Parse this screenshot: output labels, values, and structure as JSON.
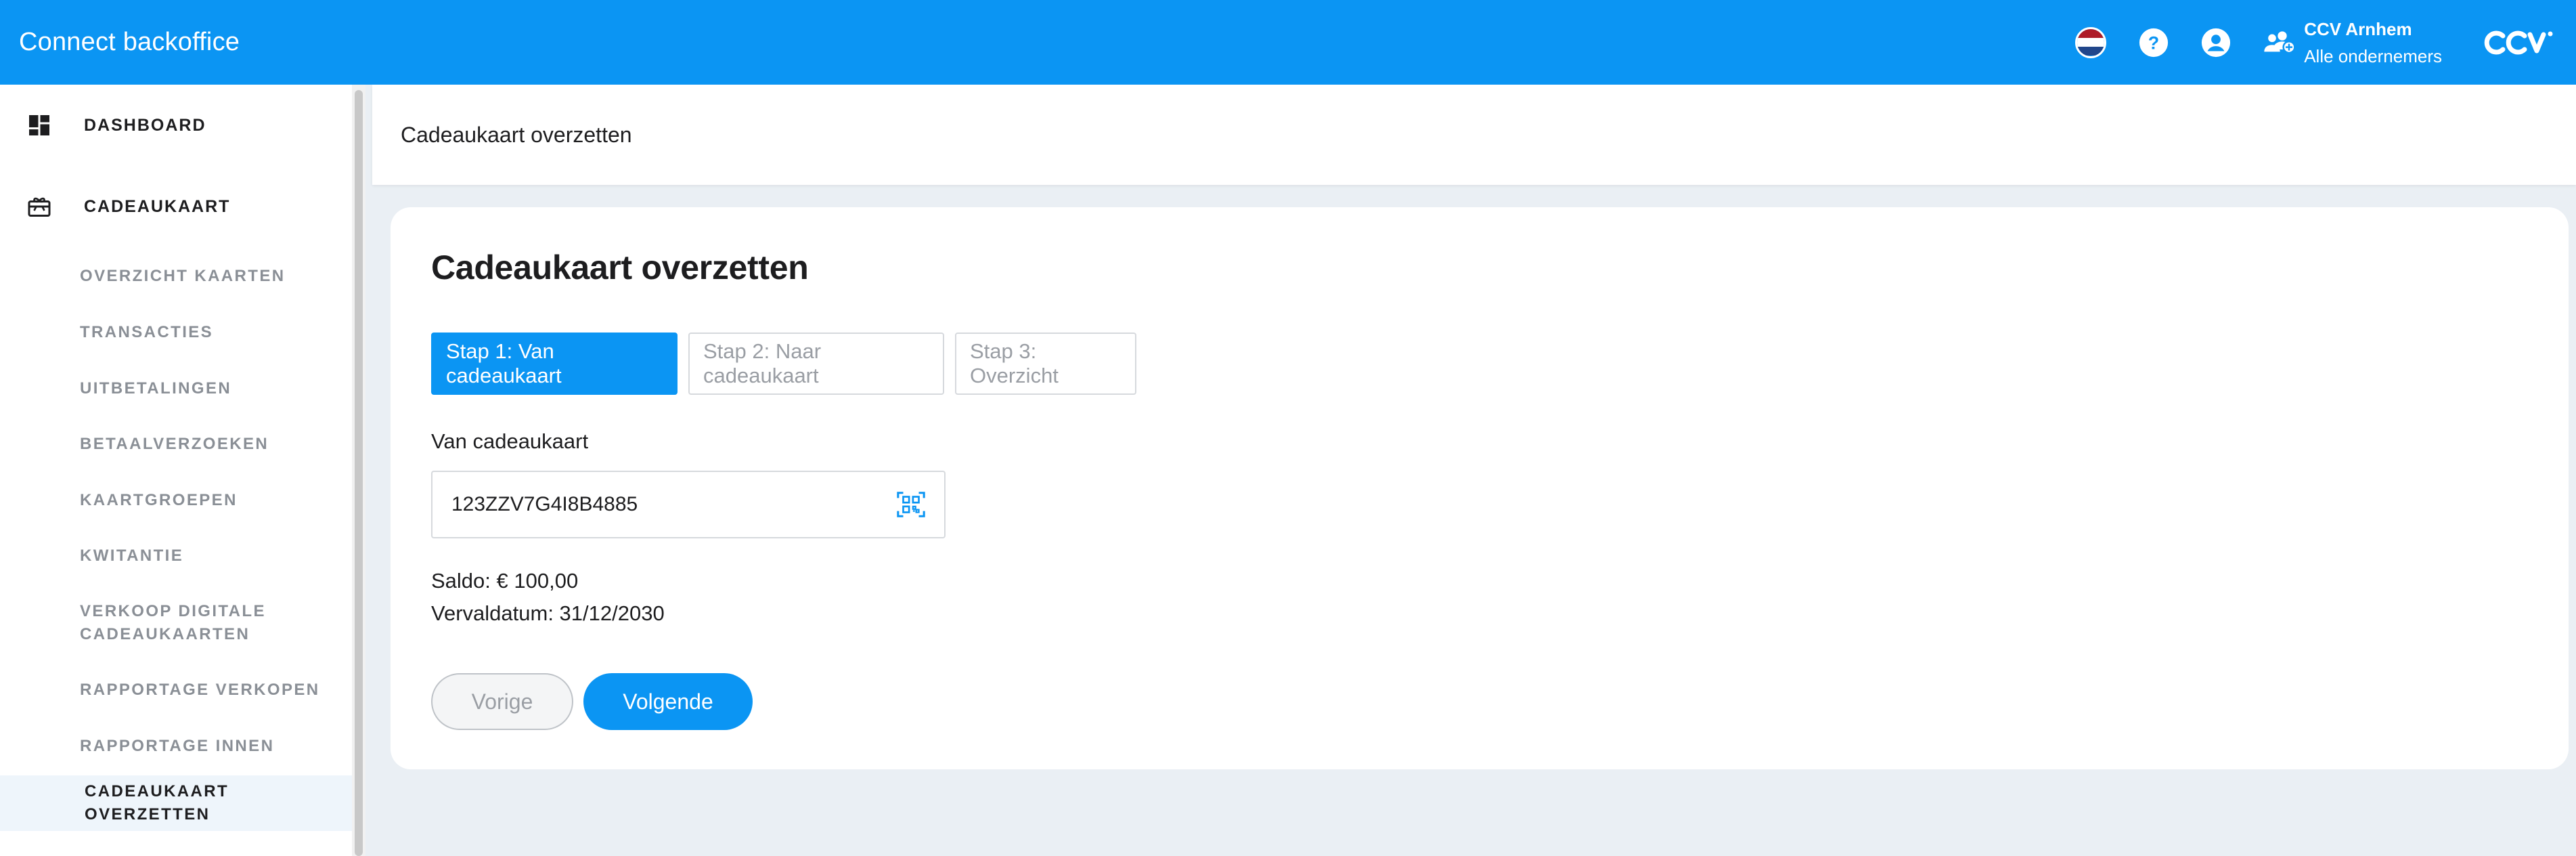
{
  "header": {
    "app_title": "Connect backoffice",
    "language_flag": "nl-flag-icon",
    "help_icon": "help-icon",
    "account_icon": "account-icon",
    "merchant": {
      "name": "CCV Arnhem",
      "scope": "Alle ondernemers",
      "icon": "users-icon"
    },
    "brand_logo": "ccv-logo"
  },
  "sidebar": {
    "main_items": [
      {
        "label": "DASHBOARD",
        "icon": "dashboard-icon"
      },
      {
        "label": "CADEAUKAART",
        "icon": "giftcard-icon"
      }
    ],
    "sub_items": [
      {
        "label": "OVERZICHT KAARTEN"
      },
      {
        "label": "TRANSACTIES"
      },
      {
        "label": "UITBETALINGEN"
      },
      {
        "label": "BETAALVERZOEKEN"
      },
      {
        "label": "KAARTGROEPEN"
      },
      {
        "label": "KWITANTIE"
      },
      {
        "label": "VERKOOP DIGITALE CADEAUKAARTEN"
      },
      {
        "label": "RAPPORTAGE VERKOPEN"
      },
      {
        "label": "RAPPORTAGE INNEN"
      },
      {
        "label": "CADEAUKAART OVERZETTEN",
        "active": true
      }
    ]
  },
  "page": {
    "breadcrumb": "Cadeaukaart overzetten",
    "title": "Cadeaukaart overzetten",
    "steps": [
      {
        "label": "Stap 1: Van cadeaukaart",
        "active": true
      },
      {
        "label": "Stap 2: Naar cadeaukaart",
        "active": false
      },
      {
        "label": "Stap 3: Overzicht",
        "active": false
      }
    ],
    "from_card_label": "Van cadeaukaart",
    "from_card_value": "123ZZV7G4I8B4885",
    "scan_icon": "qr-scan-icon",
    "balance_text": "Saldo: € 100,00",
    "expiry_text": "Vervaldatum: 31/12/2030",
    "prev_button": "Vorige",
    "next_button": "Volgende"
  },
  "colors": {
    "primary": "#0b95f3",
    "background": "#eaeff4",
    "muted_text": "#8a8f96",
    "active_nav_bg": "#eef5fb"
  }
}
